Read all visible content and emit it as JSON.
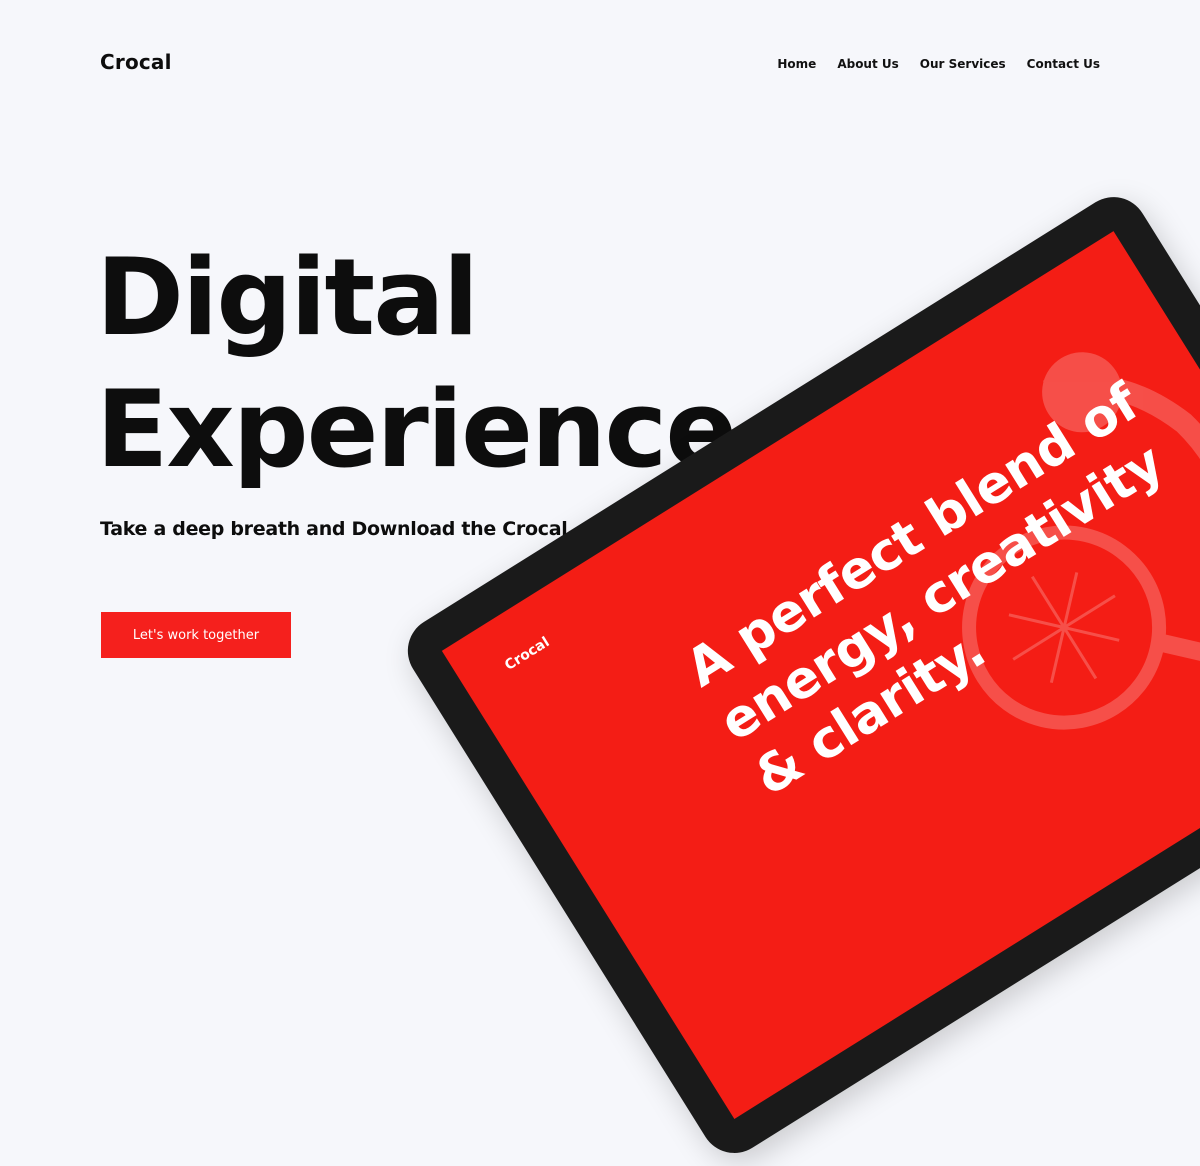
{
  "brand": {
    "logo": "Crocal"
  },
  "nav": {
    "items": [
      {
        "label": "Home"
      },
      {
        "label": "About Us"
      },
      {
        "label": "Our Services"
      },
      {
        "label": "Contact Us"
      }
    ]
  },
  "hero": {
    "title_line1": "Digital",
    "title_line2": "Experience.",
    "subtitle": "Take a deep breath and Download the Crocal.",
    "cta_label": "Let's work together"
  },
  "device_screen": {
    "logo": "Crocal",
    "headline_line1": "A perfect blend of",
    "headline_line2": "energy, creativity",
    "headline_line3": "& clarity."
  },
  "colors": {
    "accent": "#f5201d",
    "background": "#f6f7fb",
    "text": "#0d0d0d",
    "device_frame": "#1a1a1a"
  }
}
